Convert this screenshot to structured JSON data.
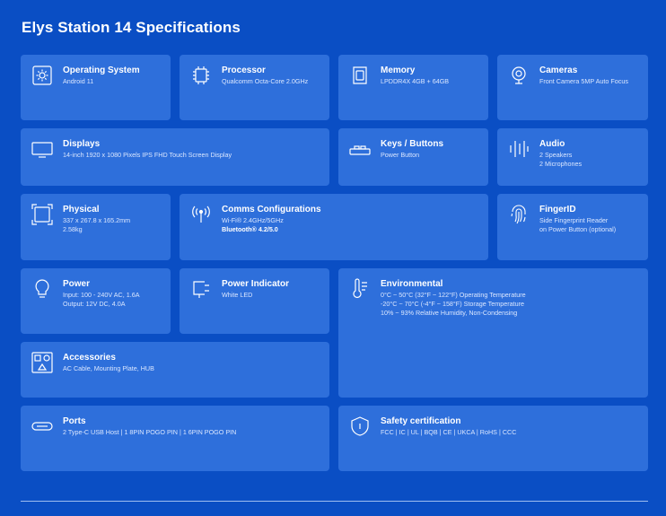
{
  "page": {
    "title": "Elys Station 14 Specifications"
  },
  "colors": {
    "background": "#0a4ec4",
    "card": "#2e6fdb",
    "text": "#ffffff",
    "subtext": "#dbe7ff"
  },
  "cards": {
    "os": {
      "icon": "gear-icon",
      "title": "Operating System",
      "lines": [
        "Android 11"
      ]
    },
    "processor": {
      "icon": "cpu-chip-icon",
      "title": "Processor",
      "lines": [
        "Qualcomm Octa-Core 2.0GHz"
      ]
    },
    "memory": {
      "icon": "memory-card-icon",
      "title": "Memory",
      "lines": [
        "LPDDR4X 4GB + 64GB"
      ]
    },
    "cameras": {
      "icon": "webcam-icon",
      "title": "Cameras",
      "lines": [
        "Front Camera 5MP Auto Focus"
      ]
    },
    "displays": {
      "icon": "monitor-icon",
      "title": "Displays",
      "lines": [
        "14-inch 1920 x 1080 Pixels IPS FHD Touch Screen Display"
      ]
    },
    "keys": {
      "icon": "keyboard-icon",
      "title": "Keys / Buttons",
      "lines": [
        "Power Button"
      ]
    },
    "audio": {
      "icon": "audio-bars-icon",
      "title": "Audio",
      "lines": [
        "2 Speakers",
        "2 Microphones"
      ]
    },
    "physical": {
      "icon": "dimensions-icon",
      "title": "Physical",
      "lines": [
        "337 x 267.8 x 165.2mm",
        "2.58kg"
      ]
    },
    "comms": {
      "icon": "antenna-icon",
      "title": "Comms Configurations",
      "lines": [
        "Wi-Fi® 2.4GHz/5GHz",
        "Bluetooth® 4.2/5.0"
      ]
    },
    "finger": {
      "icon": "fingerprint-icon",
      "title": "FingerID",
      "lines": [
        "Side Fingerprint Reader",
        "on Power Button (optional)"
      ]
    },
    "power": {
      "icon": "lightbulb-icon",
      "title": "Power",
      "lines": [
        "Input: 100 - 240V AC, 1.6A",
        "Output: 12V DC, 4.0A"
      ]
    },
    "power_indicator": {
      "icon": "led-indicator-icon",
      "title": "Power Indicator",
      "lines": [
        "White LED"
      ]
    },
    "environmental": {
      "icon": "thermometer-icon",
      "title": "Environmental",
      "lines": [
        "0°C ~ 50°C (32°F ~ 122°F) Operating Temperature",
        "-20°C ~ 70°C (-4°F ~ 158°F) Storage Temperature",
        "10% ~ 93% Relative Humidity, Non-Condensing"
      ]
    },
    "accessories": {
      "icon": "shapes-icon",
      "title": "Accessories",
      "lines": [
        "AC Cable, Mounting Plate, HUB"
      ]
    },
    "ports": {
      "icon": "usb-c-port-icon",
      "title": "Ports",
      "lines": [
        "2 Type-C USB Host | 1 8PIN POGO PIN | 1 6PIN POGO PIN"
      ]
    },
    "safety": {
      "icon": "shield-icon",
      "title": "Safety certification",
      "lines": [
        "FCC | IC | UL | BQB | CE | UKCA | RoHS | CCC"
      ]
    }
  }
}
